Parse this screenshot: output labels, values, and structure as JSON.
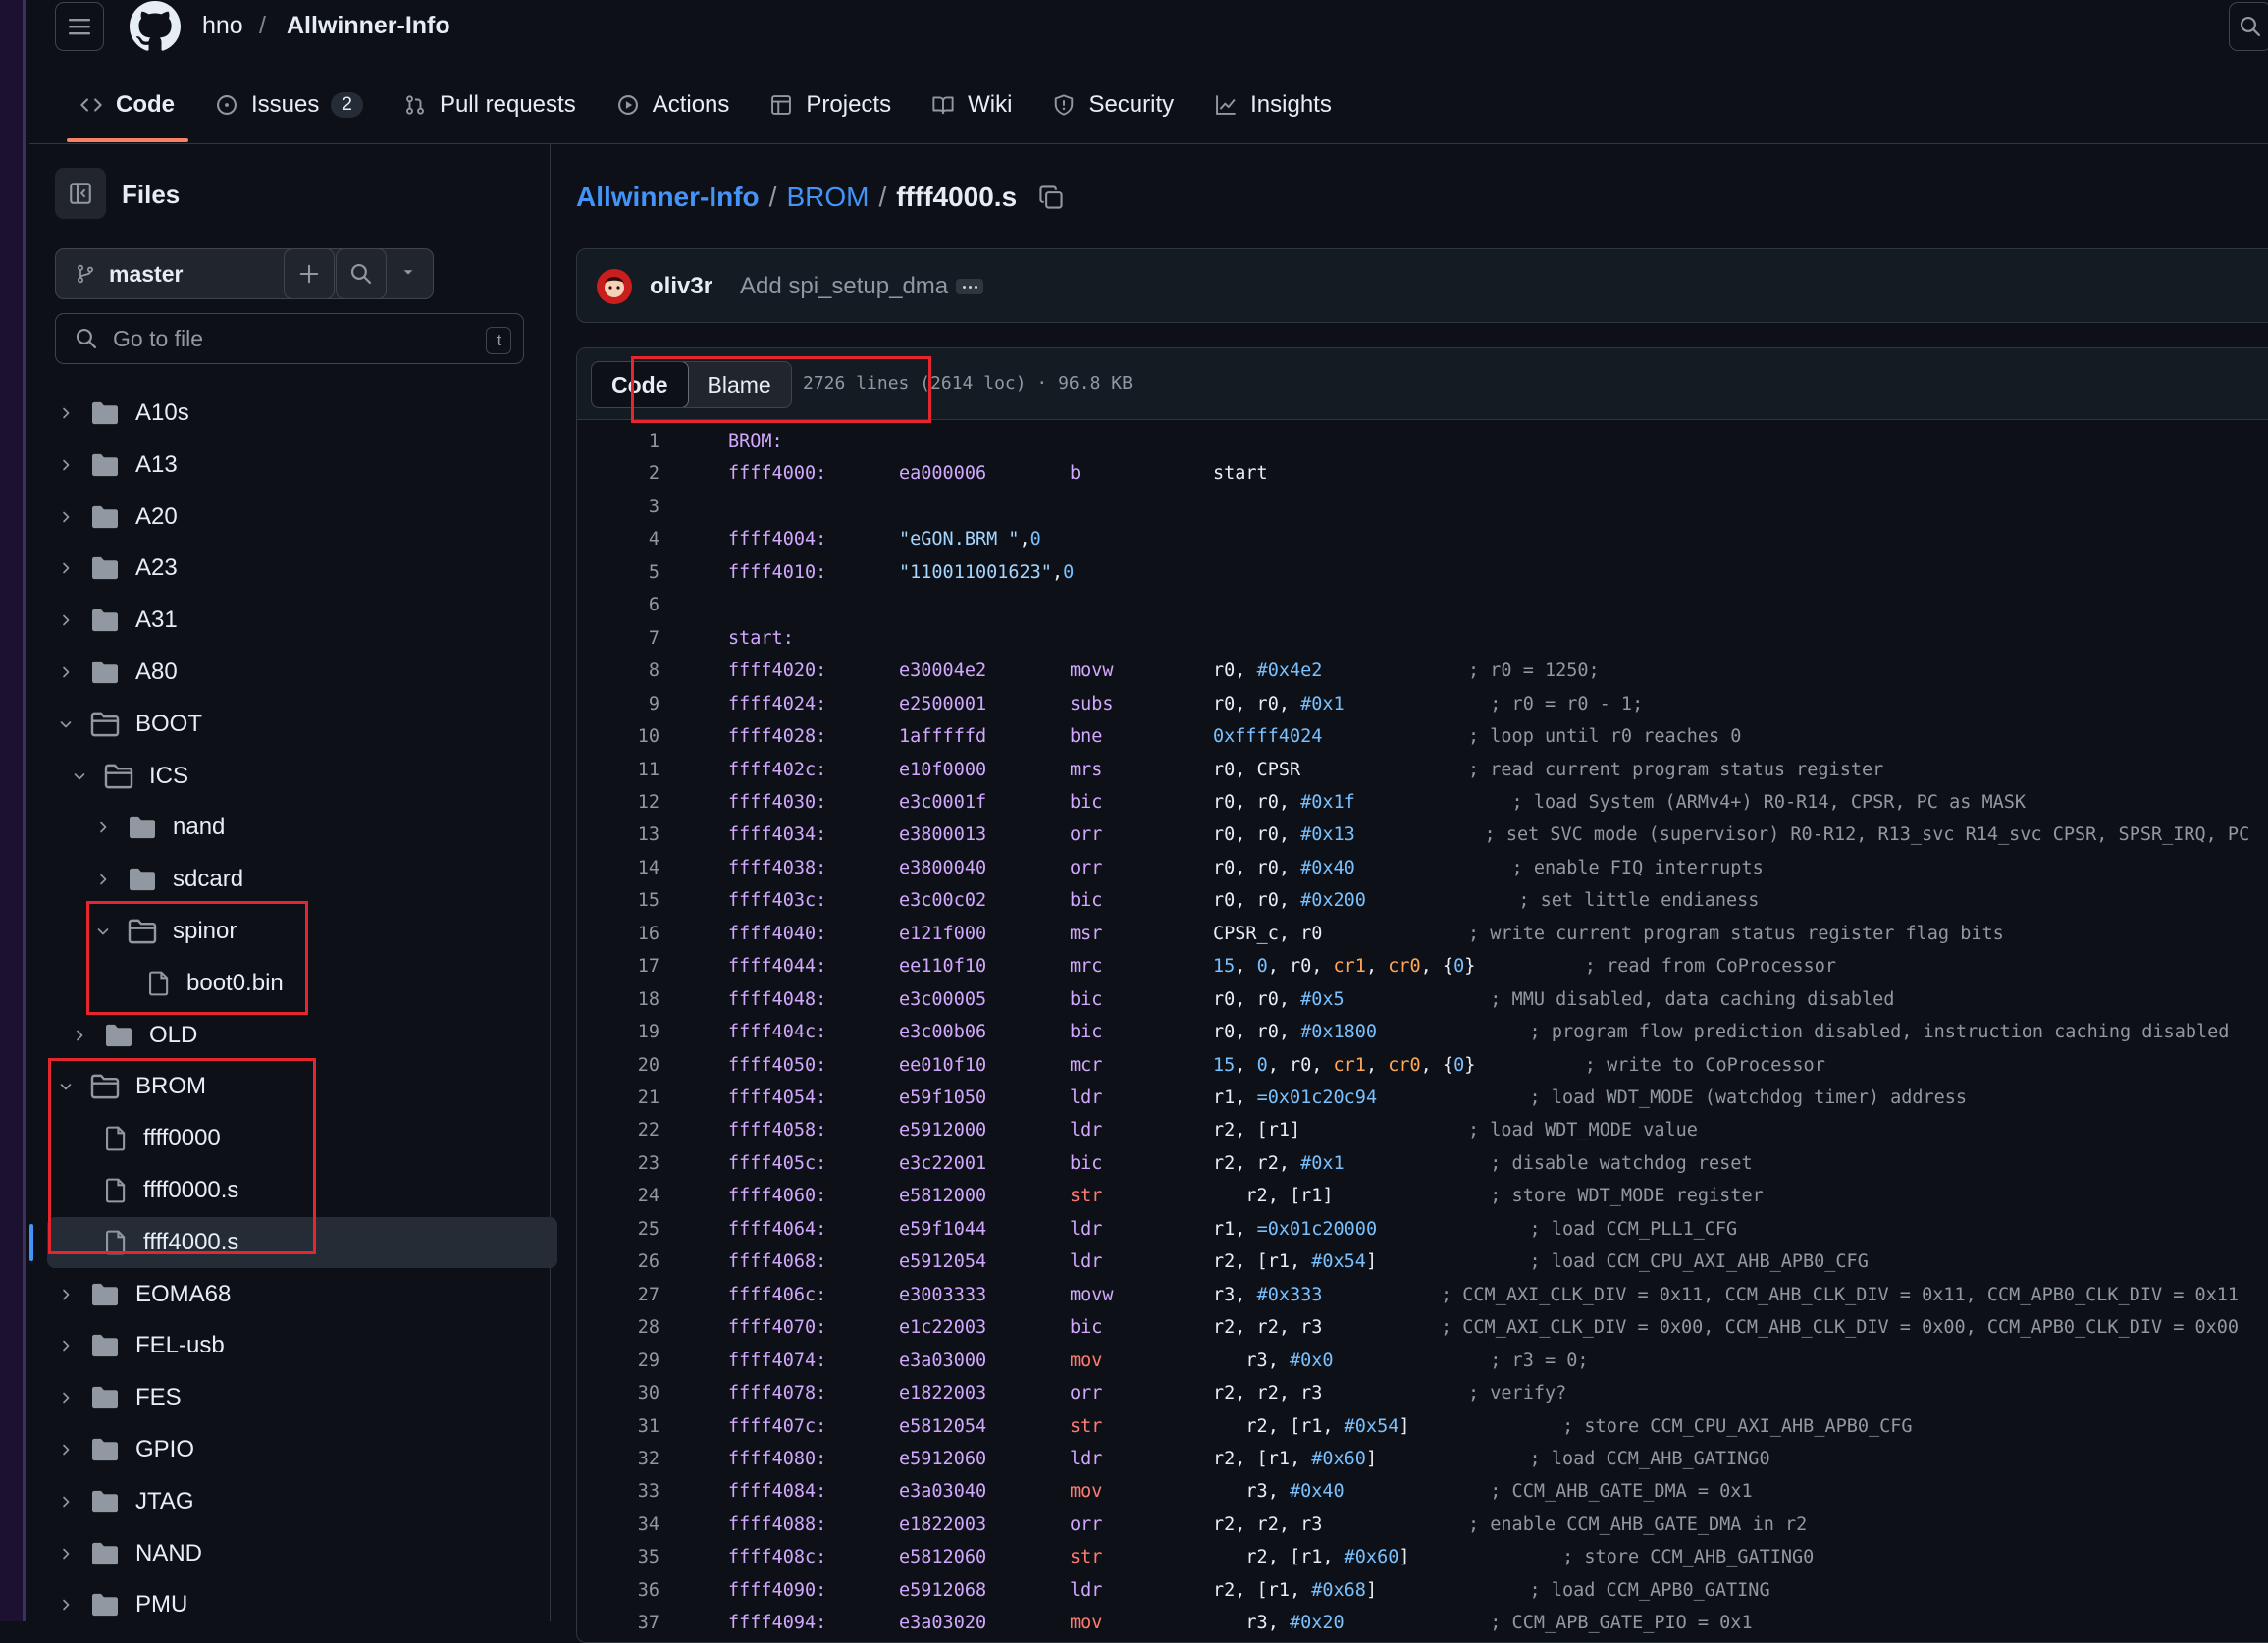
{
  "header": {
    "owner": "hno",
    "separator": "/",
    "repo": "Allwinner-Info",
    "tabs": [
      {
        "label": "Code",
        "icon": "code-icon"
      },
      {
        "label": "Issues",
        "icon": "issue-icon",
        "count": "2"
      },
      {
        "label": "Pull requests",
        "icon": "pull-request-icon"
      },
      {
        "label": "Actions",
        "icon": "play-icon"
      },
      {
        "label": "Projects",
        "icon": "table-icon"
      },
      {
        "label": "Wiki",
        "icon": "book-icon"
      },
      {
        "label": "Security",
        "icon": "shield-icon"
      },
      {
        "label": "Insights",
        "icon": "graph-icon"
      }
    ]
  },
  "sidebar": {
    "title": "Files",
    "branch": "master",
    "goto_placeholder": "Go to file",
    "goto_shortcut": "t",
    "tree": [
      {
        "name": "A10s",
        "type": "folder",
        "expanded": false
      },
      {
        "name": "A13",
        "type": "folder",
        "expanded": false
      },
      {
        "name": "A20",
        "type": "folder",
        "expanded": false
      },
      {
        "name": "A23",
        "type": "folder",
        "expanded": false
      },
      {
        "name": "A31",
        "type": "folder",
        "expanded": false
      },
      {
        "name": "A80",
        "type": "folder",
        "expanded": false
      },
      {
        "name": "BOOT",
        "type": "folder",
        "expanded": true
      },
      {
        "name": "ICS",
        "type": "folder",
        "expanded": true
      },
      {
        "name": "nand",
        "type": "folder",
        "expanded": false
      },
      {
        "name": "sdcard",
        "type": "folder",
        "expanded": false
      },
      {
        "name": "spinor",
        "type": "folder",
        "expanded": true
      },
      {
        "name": "boot0.bin",
        "type": "file"
      },
      {
        "name": "OLD",
        "type": "folder",
        "expanded": false
      },
      {
        "name": "BROM",
        "type": "folder",
        "expanded": true
      },
      {
        "name": "ffff0000",
        "type": "file"
      },
      {
        "name": "ffff0000.s",
        "type": "file"
      },
      {
        "name": "ffff4000.s",
        "type": "file",
        "selected": true
      },
      {
        "name": "EOMA68",
        "type": "folder",
        "expanded": false
      },
      {
        "name": "FEL-usb",
        "type": "folder",
        "expanded": false
      },
      {
        "name": "FES",
        "type": "folder",
        "expanded": false
      },
      {
        "name": "GPIO",
        "type": "folder",
        "expanded": false
      },
      {
        "name": "JTAG",
        "type": "folder",
        "expanded": false
      },
      {
        "name": "NAND",
        "type": "folder",
        "expanded": false
      },
      {
        "name": "PMU",
        "type": "folder",
        "expanded": false
      }
    ]
  },
  "breadcrumb": {
    "repo": "Allwinner-Info",
    "folder": "BROM",
    "file": "ffff4000.s",
    "sep": "/"
  },
  "commit": {
    "author": "oliv3r",
    "message": "Add spi_setup_dma"
  },
  "file": {
    "view_code": "Code",
    "view_blame": "Blame",
    "meta": "2726 lines (2614 loc) · 96.8 KB"
  },
  "code_lines": [
    {
      "n": "1",
      "addr": "BROM:",
      "hex": "",
      "op": "",
      "args": "",
      "comment": ""
    },
    {
      "n": "2",
      "addr": "ffff4000:",
      "hex": "ea000006",
      "op": "b",
      "args": "start",
      "comment": ""
    },
    {
      "n": "3",
      "addr": "",
      "hex": "",
      "op": "",
      "args": "",
      "comment": ""
    },
    {
      "n": "4",
      "addr": "ffff4004:",
      "hex": "\"eGON.BRM \",0",
      "op": "",
      "args": "",
      "comment": ""
    },
    {
      "n": "5",
      "addr": "ffff4010:",
      "hex": "\"110011001623\",0",
      "op": "",
      "args": "",
      "comment": ""
    },
    {
      "n": "6",
      "addr": "",
      "hex": "",
      "op": "",
      "args": "",
      "comment": ""
    },
    {
      "n": "7",
      "addr": "start:",
      "hex": "",
      "op": "",
      "args": "",
      "comment": ""
    },
    {
      "n": "8",
      "addr": "ffff4020:",
      "hex": "e30004e2",
      "op": "movw",
      "args": "r0, #0x4e2",
      "comment": "; r0 = 1250;"
    },
    {
      "n": "9",
      "addr": "ffff4024:",
      "hex": "e2500001",
      "op": "subs",
      "args": "r0, r0, #0x1",
      "comment": "  ; r0 = r0 - 1;"
    },
    {
      "n": "10",
      "addr": "ffff4028:",
      "hex": "1afffffd",
      "op": "bne",
      "args": "0xffff4024",
      "comment": "; loop until r0 reaches 0"
    },
    {
      "n": "11",
      "addr": "ffff402c:",
      "hex": "e10f0000",
      "op": "mrs",
      "args": "r0, CPSR",
      "comment": "; read current program status register"
    },
    {
      "n": "12",
      "addr": "ffff4030:",
      "hex": "e3c0001f",
      "op": "bic",
      "args": "r0, r0, #0x1f",
      "comment": "    ; load System (ARMv4+) R0-R14, CPSR, PC as MASK"
    },
    {
      "n": "13",
      "addr": "ffff4034:",
      "hex": "e3800013",
      "op": "orr",
      "args": "r0, r0, #0x13",
      "comment": "    ; set SVC mode (supervisor) R0-R12, R13_svc R14_svc CPSR, SPSR_IRQ, PC"
    },
    {
      "n": "14",
      "addr": "ffff4038:",
      "hex": "e3800040",
      "op": "orr",
      "args": "r0, r0, #0x40",
      "comment": "    ; enable FIQ interrupts"
    },
    {
      "n": "15",
      "addr": "ffff403c:",
      "hex": "e3c00c02",
      "op": "bic",
      "args": "r0, r0, #0x200",
      "comment": "    ; set little endianess"
    },
    {
      "n": "16",
      "addr": "ffff4040:",
      "hex": "e121f000",
      "op": "msr",
      "args": "CPSR_c, r0",
      "comment": "; write current program status register flag bits"
    },
    {
      "n": "17",
      "addr": "ffff4044:",
      "hex": "ee110f10",
      "op": "mrc",
      "args": "15, 0, r0, cr1, cr0, {0}",
      "comment": "; read from CoProcessor"
    },
    {
      "n": "18",
      "addr": "ffff4048:",
      "hex": "e3c00005",
      "op": "bic",
      "args": "r0, r0, #0x5",
      "comment": "  ; MMU disabled, data caching disabled"
    },
    {
      "n": "19",
      "addr": "ffff404c:",
      "hex": "e3c00b06",
      "op": "bic",
      "args": "r0, r0, #0x1800",
      "comment": "    ; program flow prediction disabled, instruction caching disabled"
    },
    {
      "n": "20",
      "addr": "ffff4050:",
      "hex": "ee010f10",
      "op": "mcr",
      "args": "15, 0, r0, cr1, cr0, {0}",
      "comment": "; write to CoProcessor"
    },
    {
      "n": "21",
      "addr": "ffff4054:",
      "hex": "e59f1050",
      "op": "ldr",
      "args": "r1, =0x01c20c94",
      "comment": "    ; load WDT_MODE (watchdog timer) address"
    },
    {
      "n": "22",
      "addr": "ffff4058:",
      "hex": "e5912000",
      "op": "ldr",
      "args": "r2, [r1]",
      "comment": "; load WDT_MODE value"
    },
    {
      "n": "23",
      "addr": "ffff405c:",
      "hex": "e3c22001",
      "op": "bic",
      "args": "r2, r2, #0x1",
      "comment": "  ; disable watchdog reset"
    },
    {
      "n": "24",
      "addr": "ffff4060:",
      "hex": "e5812000",
      "op": "str",
      "args": "   r2, [r1]",
      "comment": "  ; store WDT_MODE register"
    },
    {
      "n": "25",
      "addr": "ffff4064:",
      "hex": "e59f1044",
      "op": "ldr",
      "args": "r1, =0x01c20000",
      "comment": "    ; load CCM_PLL1_CFG"
    },
    {
      "n": "26",
      "addr": "ffff4068:",
      "hex": "e5912054",
      "op": "ldr",
      "args": "r2, [r1, #0x54]",
      "comment": "    ; load CCM_CPU_AXI_AHB_APB0_CFG"
    },
    {
      "n": "27",
      "addr": "ffff406c:",
      "hex": "e3003333",
      "op": "movw",
      "args": "r3, #0x333",
      "comment": "; CCM_AXI_CLK_DIV = 0x11, CCM_AHB_CLK_DIV = 0x11, CCM_APB0_CLK_DIV = 0x11"
    },
    {
      "n": "28",
      "addr": "ffff4070:",
      "hex": "e1c22003",
      "op": "bic",
      "args": "r2, r2, r3",
      "comment": "; CCM_AXI_CLK_DIV = 0x00, CCM_AHB_CLK_DIV = 0x00, CCM_APB0_CLK_DIV = 0x00"
    },
    {
      "n": "29",
      "addr": "ffff4074:",
      "hex": "e3a03000",
      "op": "mov",
      "args": "   r3, #0x0",
      "comment": "  ; r3 = 0;"
    },
    {
      "n": "30",
      "addr": "ffff4078:",
      "hex": "e1822003",
      "op": "orr",
      "args": "r2, r2, r3",
      "comment": "; verify?"
    },
    {
      "n": "31",
      "addr": "ffff407c:",
      "hex": "e5812054",
      "op": "str",
      "args": "   r2, [r1, #0x54]",
      "comment": "    ; store CCM_CPU_AXI_AHB_APB0_CFG"
    },
    {
      "n": "32",
      "addr": "ffff4080:",
      "hex": "e5912060",
      "op": "ldr",
      "args": "r2, [r1, #0x60]",
      "comment": "    ; load CCM_AHB_GATING0"
    },
    {
      "n": "33",
      "addr": "ffff4084:",
      "hex": "e3a03040",
      "op": "mov",
      "args": "   r3, #0x40",
      "comment": "  ; CCM_AHB_GATE_DMA = 0x1"
    },
    {
      "n": "34",
      "addr": "ffff4088:",
      "hex": "e1822003",
      "op": "orr",
      "args": "r2, r2, r3",
      "comment": "; enable CCM_AHB_GATE_DMA in r2"
    },
    {
      "n": "35",
      "addr": "ffff408c:",
      "hex": "e5812060",
      "op": "str",
      "args": "   r2, [r1, #0x60]",
      "comment": "    ; store CCM_AHB_GATING0"
    },
    {
      "n": "36",
      "addr": "ffff4090:",
      "hex": "e5912068",
      "op": "ldr",
      "args": "r2, [r1, #0x68]",
      "comment": "    ; load CCM_APB0_GATING"
    },
    {
      "n": "37",
      "addr": "ffff4094:",
      "hex": "e3a03020",
      "op": "mov",
      "args": "   r3, #0x20",
      "comment": "  ; CCM_APB_GATE_PIO = 0x1"
    }
  ],
  "colors": {
    "background": "#0d1117",
    "accent": "#4493f8",
    "tab_underline": "#f78166",
    "annotation": "#e5262e"
  }
}
